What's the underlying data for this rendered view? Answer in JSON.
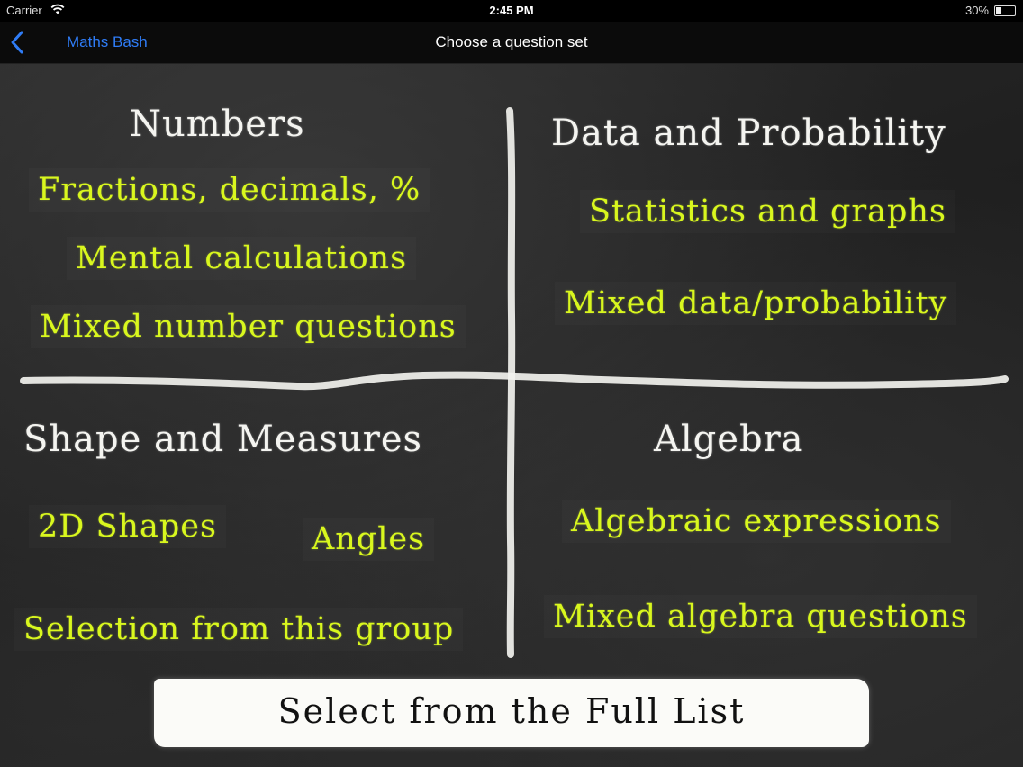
{
  "status_bar": {
    "carrier": "Carrier",
    "time": "2:45 PM",
    "battery": "30%",
    "battery_level": 0.3
  },
  "nav": {
    "back_label": "Maths Bash",
    "title": "Choose a question set",
    "accent_color": "#2f7cf6"
  },
  "groups": {
    "numbers": {
      "heading": "Numbers",
      "items": [
        "Fractions, decimals, %",
        "Mental calculations",
        "Mixed number questions"
      ]
    },
    "data_probability": {
      "heading": "Data and Probability",
      "items": [
        "Statistics and graphs",
        "Mixed data/probability"
      ]
    },
    "shape_measures": {
      "heading": "Shape and Measures",
      "items": [
        "2D Shapes",
        "Angles",
        "Selection from this group"
      ]
    },
    "algebra": {
      "heading": "Algebra",
      "items": [
        "Algebraic expressions",
        "Mixed algebra questions"
      ]
    }
  },
  "full_list_button": "Select from the Full List",
  "colors": {
    "chalk_heading": "#f4f4f0",
    "chalk_item": "#d9f71e",
    "board": "#222222"
  }
}
